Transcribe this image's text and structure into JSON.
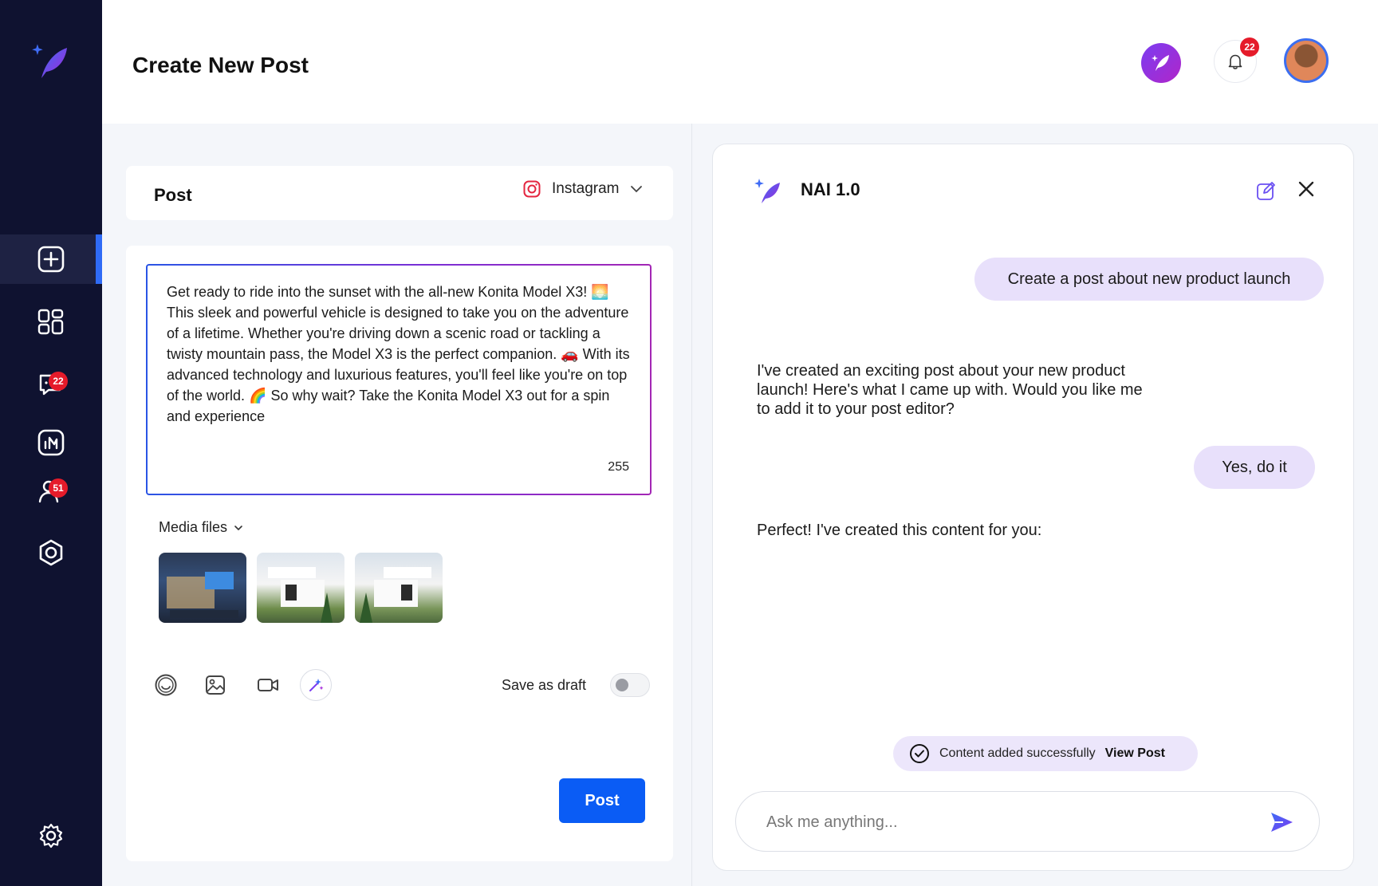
{
  "app": {
    "accent": "#0a5cf5",
    "sidebar_bg": "#0f1230",
    "ai_gradient": [
      "#7b3df1",
      "#b026c9"
    ]
  },
  "sidebar": {
    "items": [
      {
        "id": "create",
        "icon": "plus-square-icon",
        "active": true
      },
      {
        "id": "dashboard",
        "icon": "grid-icon"
      },
      {
        "id": "messages",
        "icon": "chat-icon",
        "badge": "22"
      },
      {
        "id": "analytics",
        "icon": "chart-icon"
      },
      {
        "id": "audience",
        "icon": "users-icon",
        "badge": "51"
      },
      {
        "id": "automation",
        "icon": "gear-hex-icon"
      }
    ],
    "bottom_icon": "settings-icon"
  },
  "header": {
    "title": "Create New Post",
    "notifications_badge": "22"
  },
  "post": {
    "label": "Post",
    "platform": "Instagram",
    "content": "Get ready to ride into the sunset with the all-new Konita Model X3! 🌅 This sleek and powerful vehicle is designed to take you on the adventure of a lifetime. Whether you're driving down a scenic road or tackling a twisty mountain pass, the Model X3 is the perfect companion. 🚗 With its advanced technology and luxurious features, you'll feel like you're on top of the world. 🌈 So why wait? Take the Konita Model X3 out for a spin and experience",
    "char_count": "255",
    "media_label": "Media files",
    "save_draft_label": "Save as draft",
    "save_draft_on": false,
    "post_button": "Post"
  },
  "chat": {
    "title": "NAI 1.0",
    "messages": [
      {
        "from": "user",
        "text": "Create a post about new product launch"
      },
      {
        "from": "bot",
        "text": "I've created an exciting post about your new product launch! Here's what I came up with. Would you like me to add it to your post editor?"
      },
      {
        "from": "user",
        "text": "Yes, do it"
      },
      {
        "from": "bot",
        "text": "Perfect! I've created this content for you:"
      }
    ],
    "toast": {
      "text": "Content added successfully",
      "link": "View Post"
    },
    "input_placeholder": "Ask me anything..."
  }
}
